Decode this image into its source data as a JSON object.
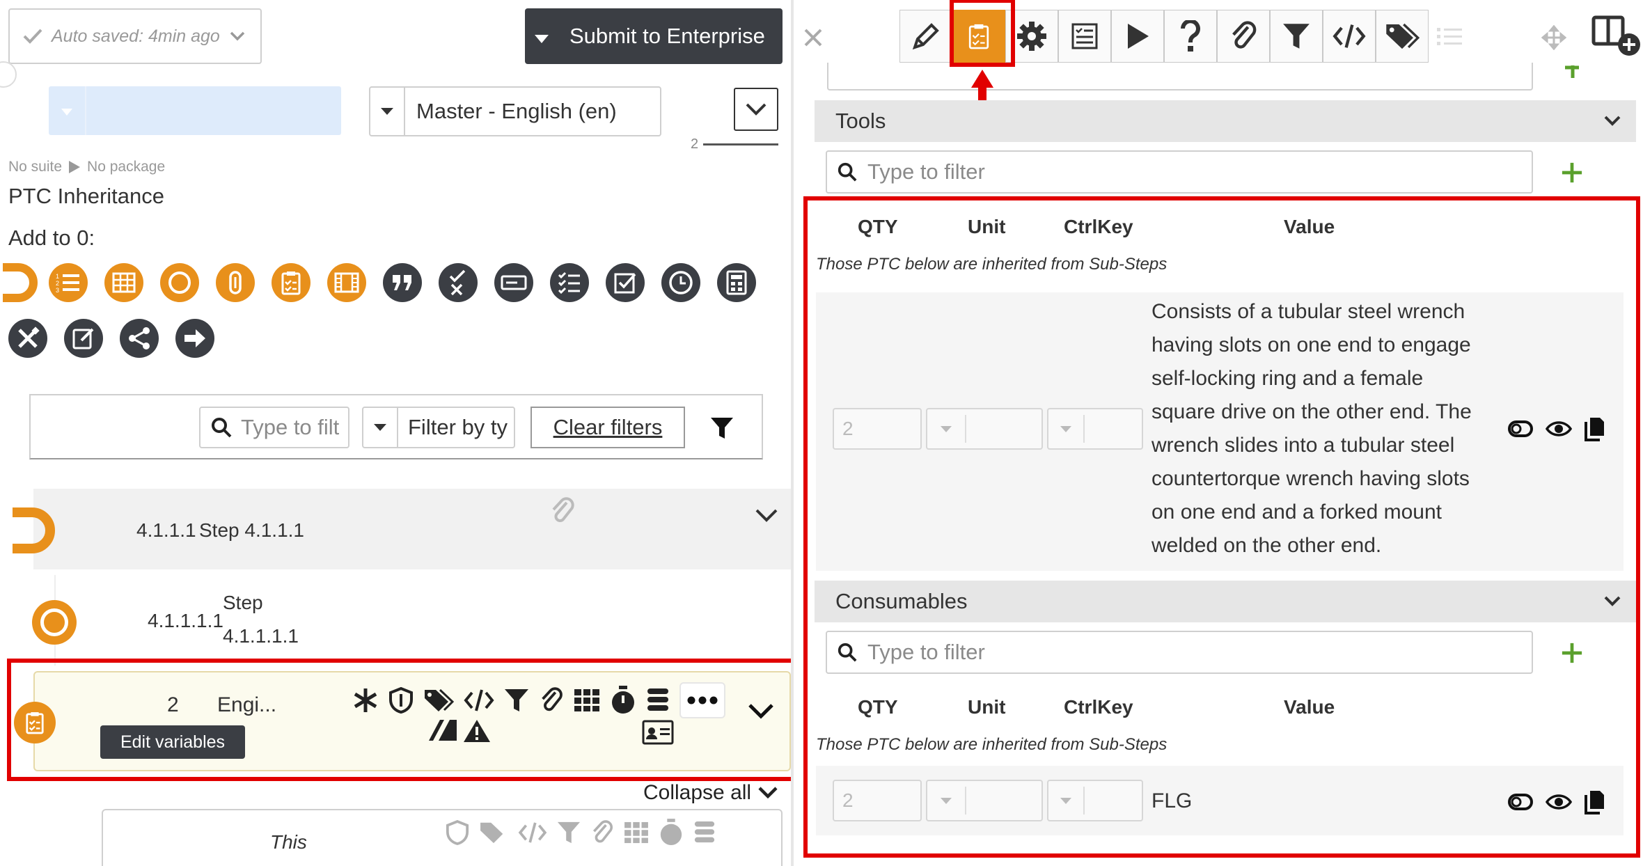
{
  "left": {
    "autosave": "Auto saved: 4min ago",
    "submit_label": "Submit to Enterprise",
    "language_select": "Master - English (en)",
    "page_count": "2",
    "breadcrumb": {
      "suite": "No suite",
      "package": "No package"
    },
    "title": "PTC Inheritance",
    "add_to": "Add to 0:",
    "filter": {
      "search_placeholder": "Type to filt",
      "type_placeholder": "Filter by ty",
      "clear_label": "Clear filters"
    },
    "steps": [
      {
        "number": "4.1.1.1",
        "label": "Step 4.1.1.1"
      },
      {
        "number": "4.1.1.1.1",
        "label_line1": "Step",
        "label_line2": "4.1.1.1.1"
      }
    ],
    "selected_row": {
      "number": "2",
      "label": "Engi...",
      "tooltip": "Edit variables"
    },
    "collapse_all": "Collapse all",
    "next_row_text": "This"
  },
  "right": {
    "tools_label": "Tools",
    "tools_filter_placeholder": "Type to filter",
    "columns": {
      "qty": "QTY",
      "unit": "Unit",
      "ctrlkey": "CtrlKey",
      "value": "Value"
    },
    "inherited_note": "Those PTC below are inherited from Sub-Steps",
    "tool_row": {
      "qty": "2",
      "value_lines": [
        "Consists of a tubular steel wrench",
        "having slots on one end to engage",
        "self-locking ring and a female",
        "square drive on the other end. The",
        "wrench slides into a tubular steel",
        "countertorque wrench having slots",
        "on one end and a forked mount",
        "welded on the other end."
      ]
    },
    "consumables_label": "Consumables",
    "consumables_filter_placeholder": "Type to filter",
    "consumable_row": {
      "qty": "2",
      "value": "FLG"
    }
  },
  "colors": {
    "orange": "#e8901b",
    "dark": "#3b3e44",
    "highlight": "#e10000",
    "green": "#5aa02c"
  }
}
